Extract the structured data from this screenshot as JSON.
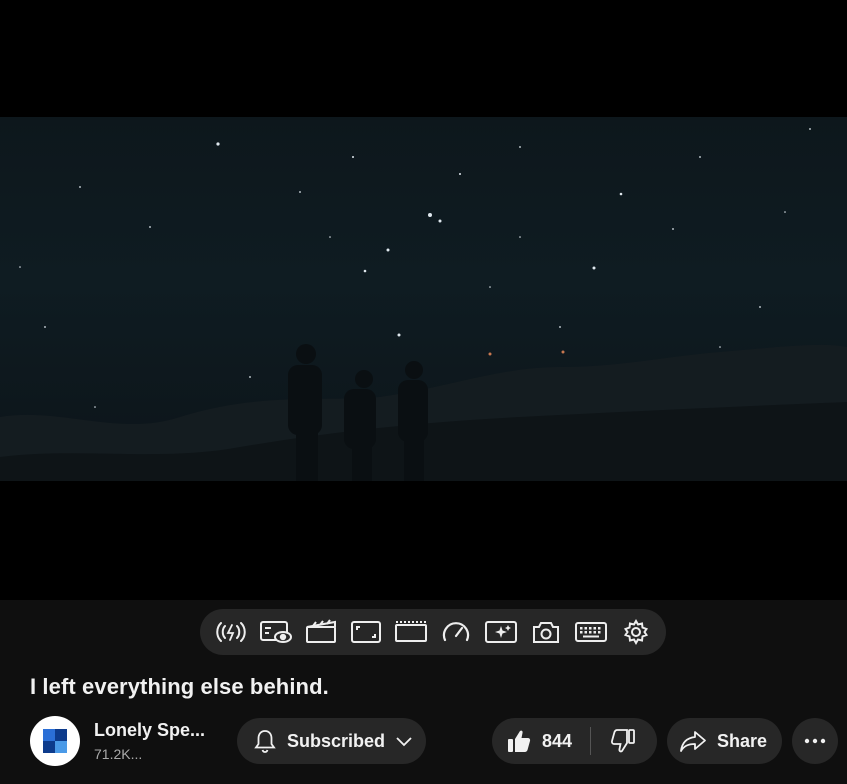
{
  "video": {
    "title": "I left everything else behind."
  },
  "toolbar": {
    "items": [
      {
        "icon": "live-signal-icon"
      },
      {
        "icon": "watch-overlay-icon"
      },
      {
        "icon": "cinema-mode-icon"
      },
      {
        "icon": "crop-icon"
      },
      {
        "icon": "theater-size-icon"
      },
      {
        "icon": "speed-icon"
      },
      {
        "icon": "enhance-icon"
      },
      {
        "icon": "screenshot-icon"
      },
      {
        "icon": "keyboard-icon"
      },
      {
        "icon": "settings-gear-icon"
      }
    ]
  },
  "channel": {
    "name": "Lonely Spe...",
    "subscribers": "71.2K...",
    "avatar_colors": [
      "#2b6fd6",
      "#0d3b8c",
      "#4a9ae8"
    ]
  },
  "actions": {
    "subscribe_label": "Subscribed",
    "like_count": "844",
    "share_label": "Share"
  }
}
